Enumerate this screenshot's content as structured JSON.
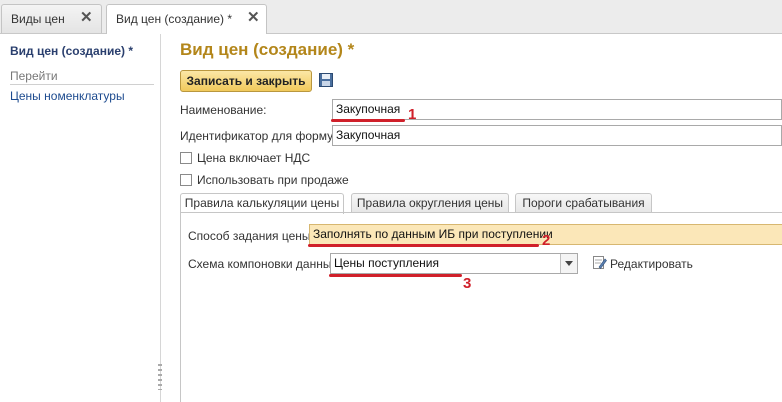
{
  "window_tabs": [
    {
      "label": "Виды цен",
      "active": false
    },
    {
      "label": "Вид цен (создание) *",
      "active": true
    }
  ],
  "sidebar": {
    "title": "Вид цен (создание) *",
    "section": "Перейти",
    "links": [
      "Цены номенклатуры"
    ]
  },
  "form": {
    "title": "Вид цен (создание) *",
    "save_close_label": "Записать и закрыть",
    "name_label": "Наименование:",
    "name_value": "Закупочная",
    "id_label": "Идентификатор для формул:",
    "id_value": "Закупочная",
    "vat_label": "Цена включает НДС",
    "sale_label": "Использовать при продаже",
    "tabs": [
      "Правила калькуляции цены",
      "Правила округления цены",
      "Пороги срабатывания"
    ],
    "method_label": "Способ задания цены:",
    "method_value": "Заполнять по данным ИБ при поступлении",
    "schema_label": "Схема компоновки данных:",
    "schema_value": "Цены поступления",
    "edit_label": "Редактировать"
  },
  "annotations": [
    "1",
    "2",
    "3"
  ],
  "colors": {
    "accent_title": "#b3861a",
    "highlight_field": "#fbe7b8",
    "annotation": "#d0202a"
  }
}
